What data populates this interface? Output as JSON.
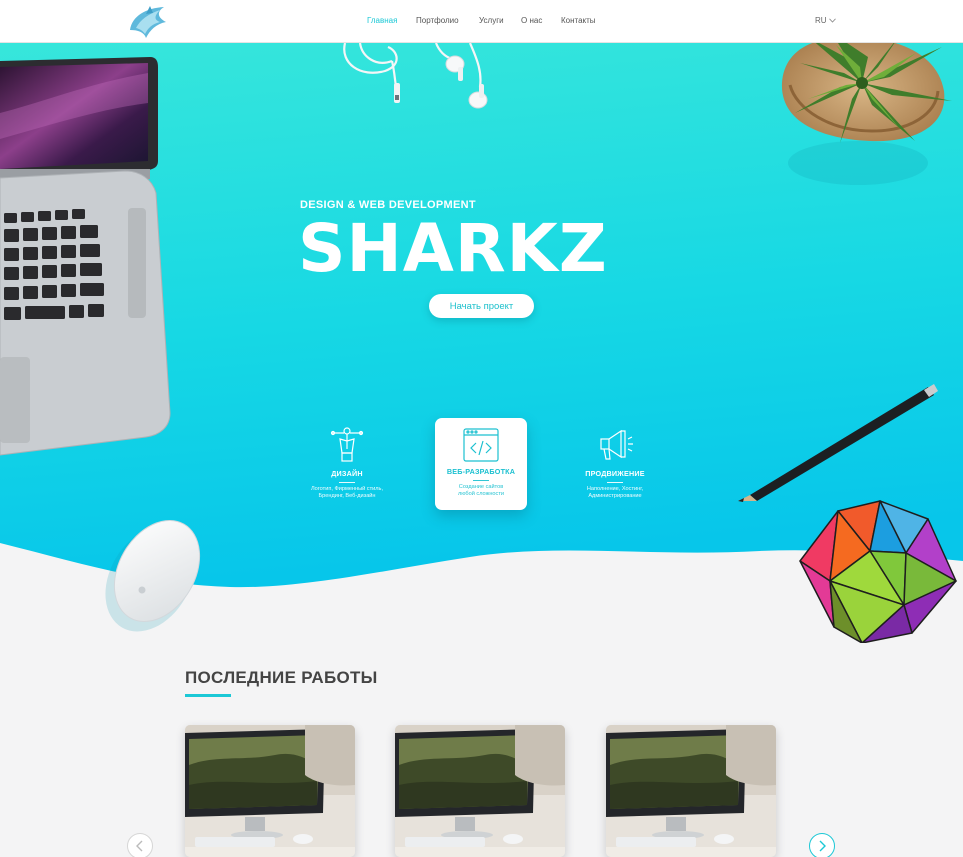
{
  "header": {
    "nav": [
      "Главная",
      "Портфолио",
      "Услуги",
      "О нас",
      "Контакты"
    ],
    "active_index": 0,
    "language": "RU"
  },
  "hero": {
    "subtitle": "DESIGN & WEB DEVELOPMENT",
    "title": "SHARKZ",
    "cta_label": "Начать проект"
  },
  "services": [
    {
      "title": "ДИЗАЙН",
      "desc_line1": "Логотип, Фирменный стиль,",
      "desc_line2": "Брендинг, Веб-дизайн",
      "icon": "pen-tool-icon"
    },
    {
      "title": "ВЕБ-РАЗРАБОТКА",
      "desc_line1": "Создание сайтов",
      "desc_line2": "любой сложности",
      "icon": "code-window-icon"
    },
    {
      "title": "ПРОДВИЖЕНИЕ",
      "desc_line1": "Наполнение, Хостинг,",
      "desc_line2": "Администрирование",
      "icon": "megaphone-icon"
    }
  ],
  "works": {
    "title": "ПОСЛЕДНИЕ РАБОТЫ",
    "items_count": 3
  },
  "colors": {
    "accent": "#1cc8d6",
    "hero_gradient_top": "#36e6dc",
    "hero_gradient_bottom": "#0ccbe8",
    "background": "#f4f4f5"
  }
}
